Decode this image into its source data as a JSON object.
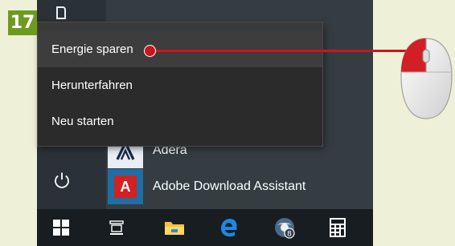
{
  "step_badge": "17",
  "power_menu": {
    "items": [
      {
        "label": "Energie sparen",
        "selected": true
      },
      {
        "label": "Herunterfahren",
        "selected": false
      },
      {
        "label": "Neu starten",
        "selected": false
      }
    ]
  },
  "start_menu": {
    "apps": [
      {
        "label": "Adera",
        "icon": "adera-icon"
      },
      {
        "label": "Adobe Download Assistant",
        "icon": "adobe-icon"
      }
    ],
    "left_icons": [
      "document-icon",
      "power-icon"
    ]
  },
  "taskbar": {
    "items": [
      {
        "name": "start",
        "icon": "windows-logo-icon"
      },
      {
        "name": "task-view",
        "icon": "task-view-icon"
      },
      {
        "name": "file-explorer",
        "icon": "folder-icon"
      },
      {
        "name": "edge",
        "icon": "edge-icon"
      },
      {
        "name": "app",
        "icon": "globe-icon"
      },
      {
        "name": "calculator",
        "icon": "calculator-icon"
      }
    ]
  },
  "colors": {
    "badge": "#6e9a1e",
    "pointer": "#c8161f",
    "menu_bg": "#2b2b2b",
    "taskbar_bg": "#171d20"
  }
}
